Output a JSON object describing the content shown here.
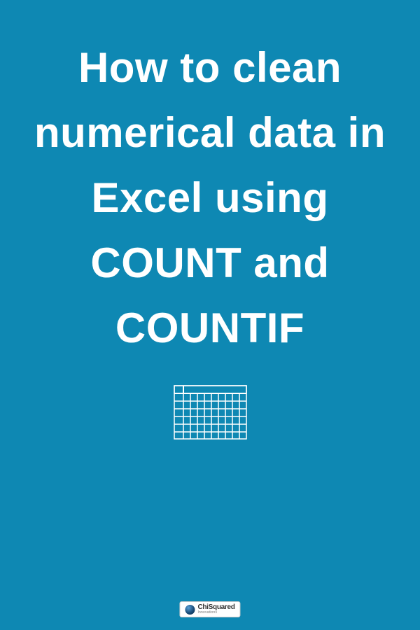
{
  "title": "How to clean numerical data in Excel using COUNT and COUNTIF",
  "colors": {
    "background": "#0e88b3",
    "text": "#ffffff",
    "icon_stroke": "#ffffff"
  },
  "logo": {
    "brand": "ChiSquared",
    "subtitle": "Innovations"
  }
}
